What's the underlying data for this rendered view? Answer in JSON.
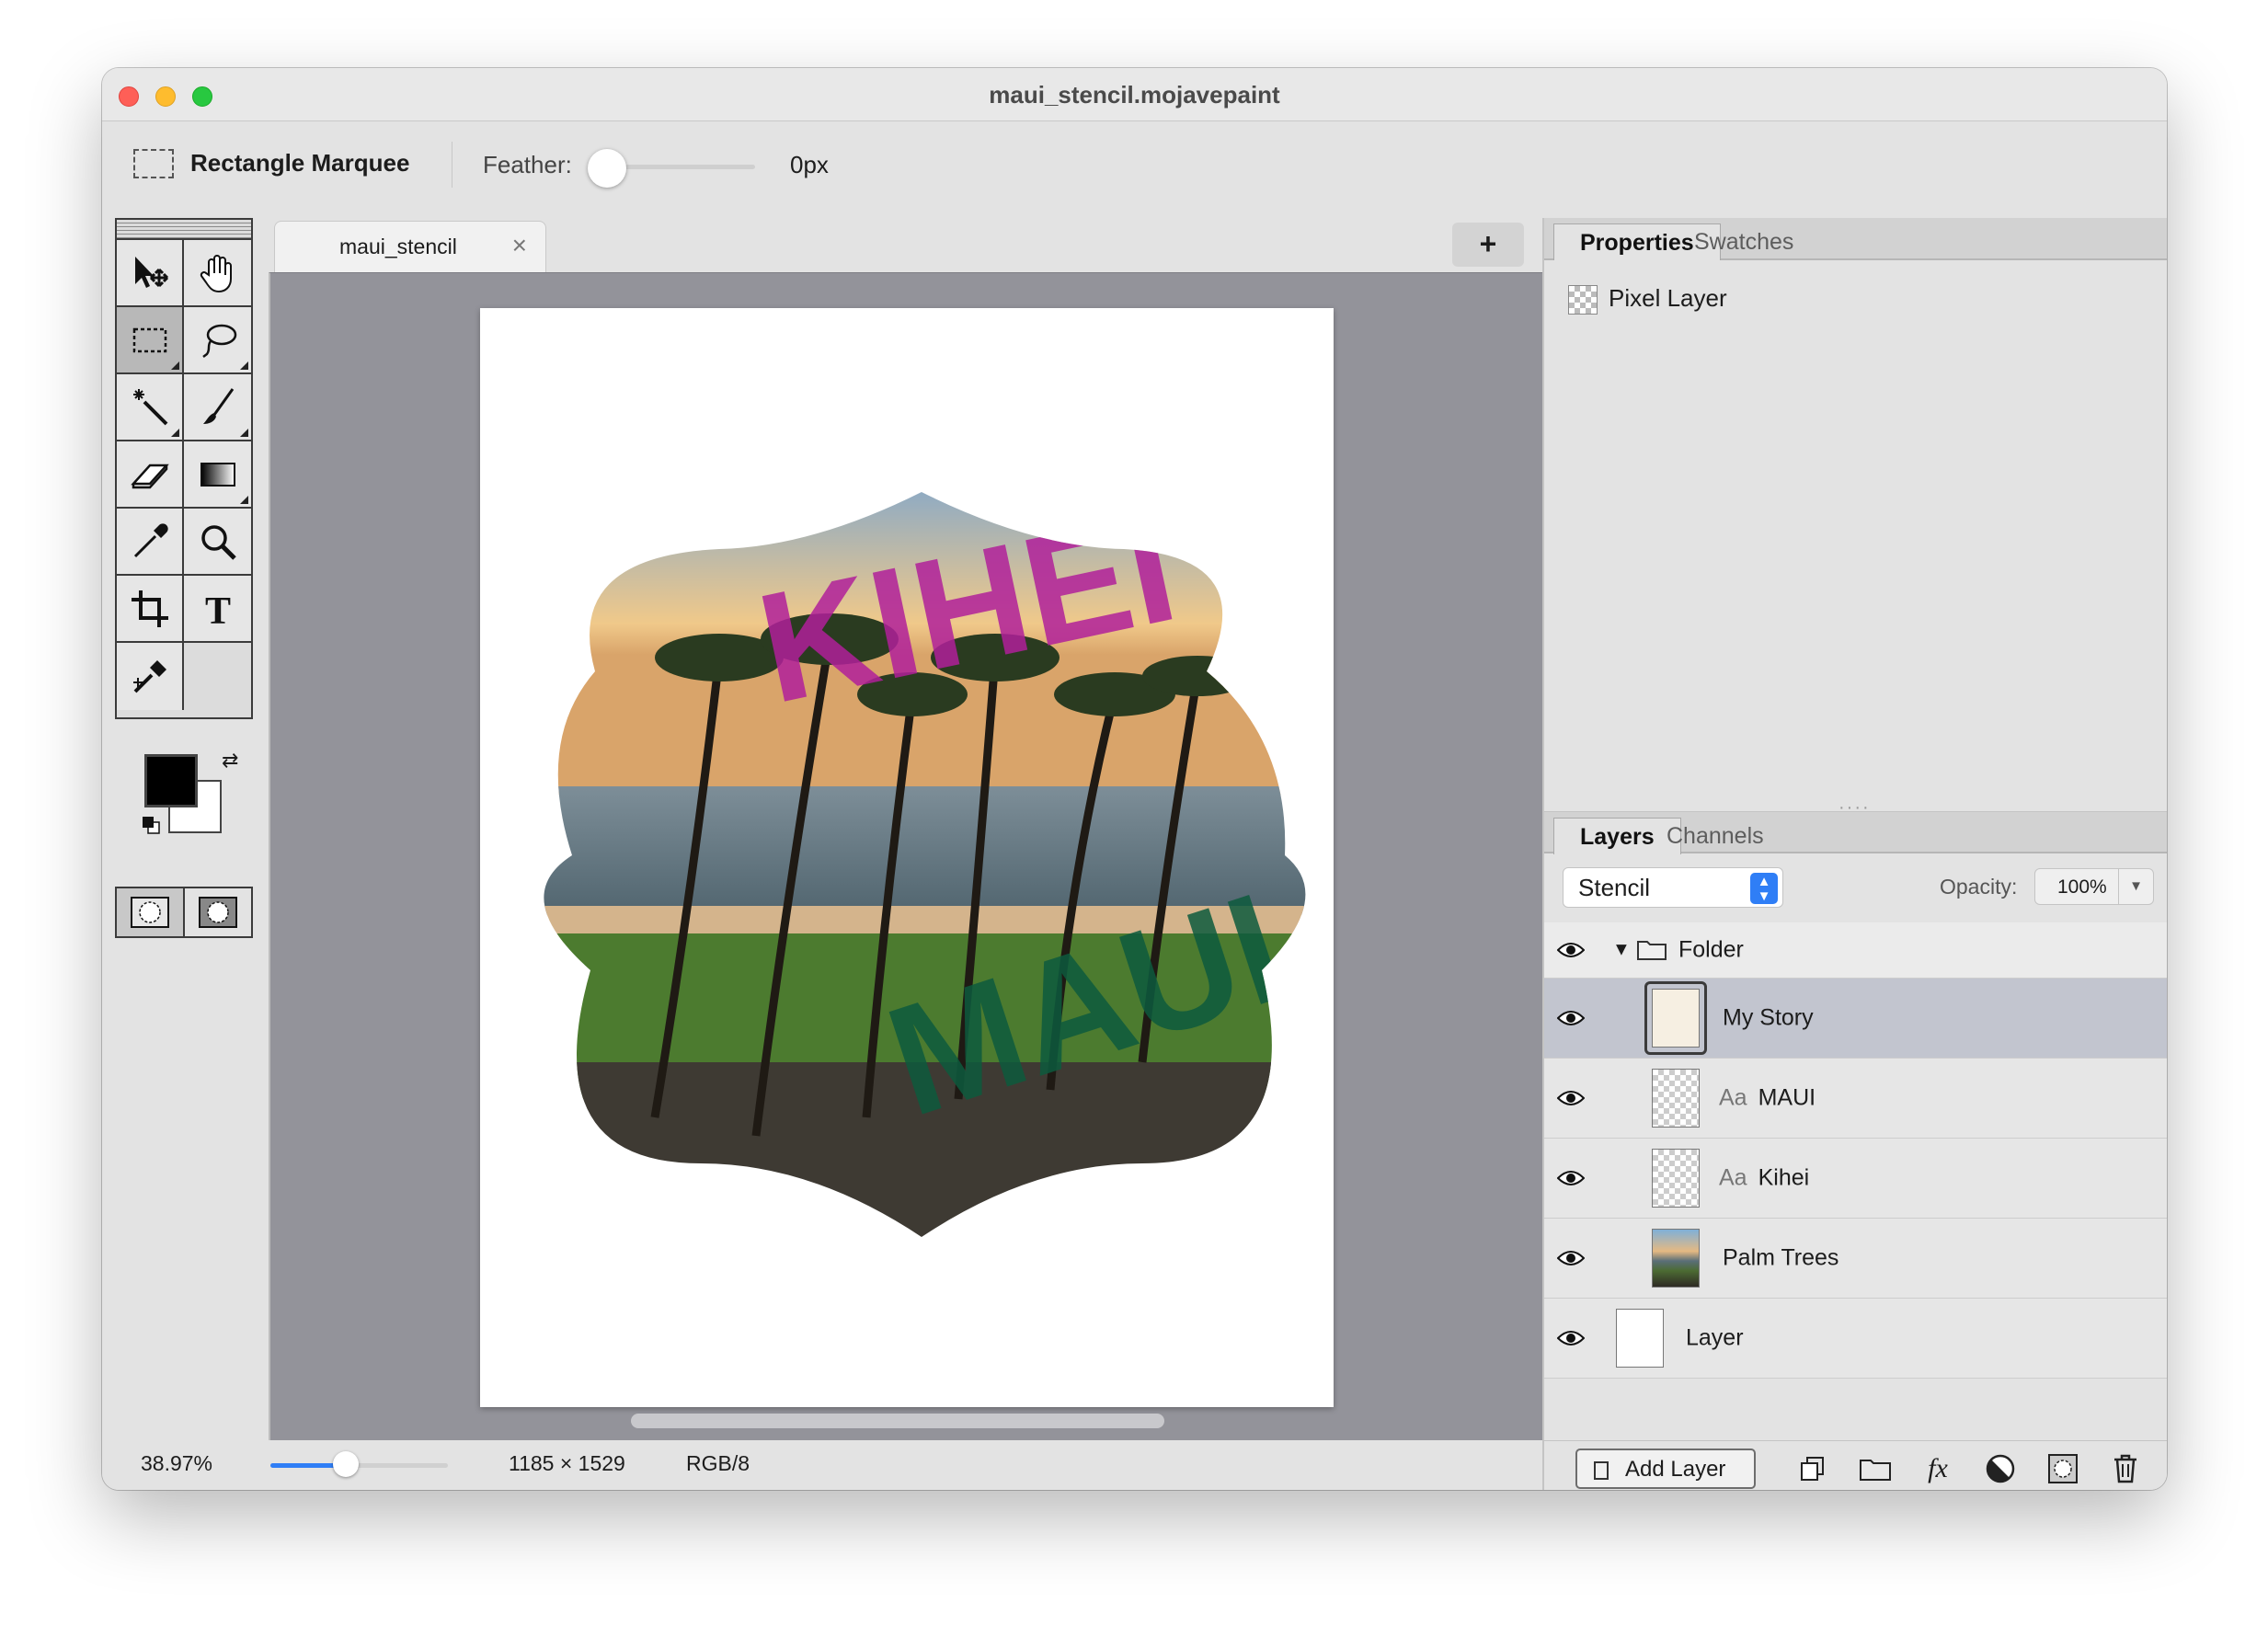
{
  "window": {
    "title": "maui_stencil.mojavepaint"
  },
  "options": {
    "tool_name": "Rectangle Marquee",
    "feather_label": "Feather:",
    "feather_value": "0px",
    "feather_fraction": 0
  },
  "document_tab": {
    "label": "maui_stencil",
    "close": "×",
    "new_tab": "+"
  },
  "canvas": {
    "top_text": "KIHEI",
    "bottom_text": "MAUI",
    "colors": {
      "kihei": "#b0209a",
      "maui": "#0d5b3d",
      "sky": "#f0c98a",
      "ocean": "#6d8595",
      "grass": "#4c7b2f"
    }
  },
  "status": {
    "zoom": "38.97%",
    "zoom_fraction": 0.42,
    "dimensions": "1185 × 1529",
    "color_mode": "RGB/8"
  },
  "properties_panel": {
    "tabs": [
      "Properties",
      "Swatches"
    ],
    "active_tab": "Properties",
    "layer_type": "Pixel Layer"
  },
  "layers_panel": {
    "tabs": [
      "Layers",
      "Channels"
    ],
    "active_tab": "Layers",
    "blend_mode": "Stencil",
    "opacity_label": "Opacity:",
    "opacity_value": "100%",
    "layers": [
      {
        "name": "Folder",
        "kind": "folder",
        "prefix": ""
      },
      {
        "name": "My Story",
        "kind": "pixel",
        "prefix": "",
        "selected": true
      },
      {
        "name": "MAUI",
        "kind": "text",
        "prefix": "Aa"
      },
      {
        "name": "Kihei",
        "kind": "text",
        "prefix": "Aa"
      },
      {
        "name": "Palm Trees",
        "kind": "photo",
        "prefix": ""
      },
      {
        "name": "Layer",
        "kind": "blank",
        "prefix": ""
      }
    ],
    "add_layer_label": "Add Layer",
    "fx_label": "fx"
  },
  "icons": [
    "marquee-icon",
    "move-icon",
    "hand-icon",
    "lasso-icon",
    "magic-wand-icon",
    "brush-icon",
    "eraser-icon",
    "gradient-icon",
    "eyedropper-icon",
    "zoom-icon",
    "crop-icon",
    "text-icon",
    "clone-stamp-icon",
    "eye-icon",
    "folder-icon",
    "duplicate-layer-icon",
    "new-folder-icon",
    "fx-icon",
    "adjustment-icon",
    "mask-icon",
    "trash-icon"
  ]
}
